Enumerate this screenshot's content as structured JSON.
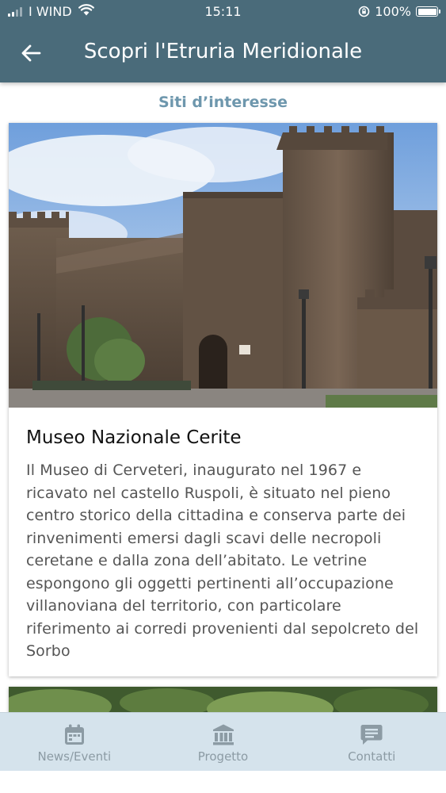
{
  "status_bar": {
    "carrier": "I WIND",
    "time": "15:11",
    "battery": "100%"
  },
  "header": {
    "title": "Scopri l'Etruria Meridionale"
  },
  "section": {
    "title": "Siti d’interesse"
  },
  "cards": [
    {
      "title": "Museo Nazionale Cerite",
      "description": "Il Museo di Cerveteri, inaugurato nel 1967 e ricavato nel castello Ruspoli, è situato nel pieno centro storico della cittadina e conserva parte dei rinvenimenti emersi dagli scavi delle necropoli ceretane e dalla zona dell’abitato. Le vetrine espongono gli oggetti pertinenti all’occupazione villanoviana del territorio, con particolare riferimento ai corredi provenienti dal sepolcreto del Sorbo"
    }
  ],
  "tabs": [
    {
      "label": "News/Eventi",
      "icon": "calendar-icon"
    },
    {
      "label": "Progetto",
      "icon": "museum-icon"
    },
    {
      "label": "Contatti",
      "icon": "chat-icon"
    }
  ],
  "colors": {
    "header": "#4a6b7a",
    "section_title": "#6e97ad",
    "tab_bar": "#d5e3ec",
    "tab_inactive": "#8c9ba4"
  }
}
